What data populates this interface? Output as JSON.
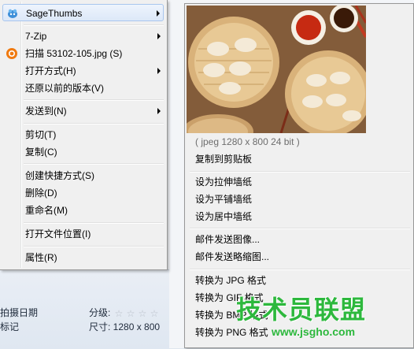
{
  "menu": {
    "items": [
      {
        "label": "SageThumbs",
        "submenu": true,
        "icon": "sagethumbs-icon",
        "highlighted": true
      },
      {
        "label": "7-Zip",
        "submenu": true
      },
      {
        "label": "扫描 53102-105.jpg (S)",
        "icon": "antivirus-icon"
      },
      {
        "label": "打开方式(H)",
        "submenu": true
      },
      {
        "label": "还原以前的版本(V)"
      },
      {
        "label": "发送到(N)",
        "submenu": true
      },
      {
        "label": "剪切(T)"
      },
      {
        "label": "复制(C)"
      },
      {
        "label": "创建快捷方式(S)"
      },
      {
        "label": "删除(D)"
      },
      {
        "label": "重命名(M)"
      },
      {
        "label": "打开文件位置(I)"
      },
      {
        "label": "属性(R)"
      }
    ]
  },
  "submenu": {
    "image_info": "( jpeg 1280 x 800 24 bit )",
    "items": [
      {
        "label": "复制到剪贴板"
      },
      {
        "label": "设为拉伸墙纸"
      },
      {
        "label": "设为平铺墙纸"
      },
      {
        "label": "设为居中墙纸"
      },
      {
        "label": "邮件发送图像..."
      },
      {
        "label": "邮件发送略缩图..."
      },
      {
        "label": "转换为 JPG 格式"
      },
      {
        "label": "转换为 GIF 格式"
      },
      {
        "label": "转换为 BMP 格式"
      },
      {
        "label": "转换为 PNG 格式"
      }
    ]
  },
  "details": {
    "date_label": "拍摄日期",
    "rating_label": "分级:",
    "tags_label": "标记",
    "size_label": "尺寸: 1280 x 800",
    "rating_stars": 0
  },
  "watermark": {
    "main": "技术员联盟",
    "sub": "www.jsgho.com"
  },
  "colors": {
    "menu_bg": "#f0f0f0",
    "highlight_border": "#a8c6ee",
    "watermark": "#2db83d"
  }
}
